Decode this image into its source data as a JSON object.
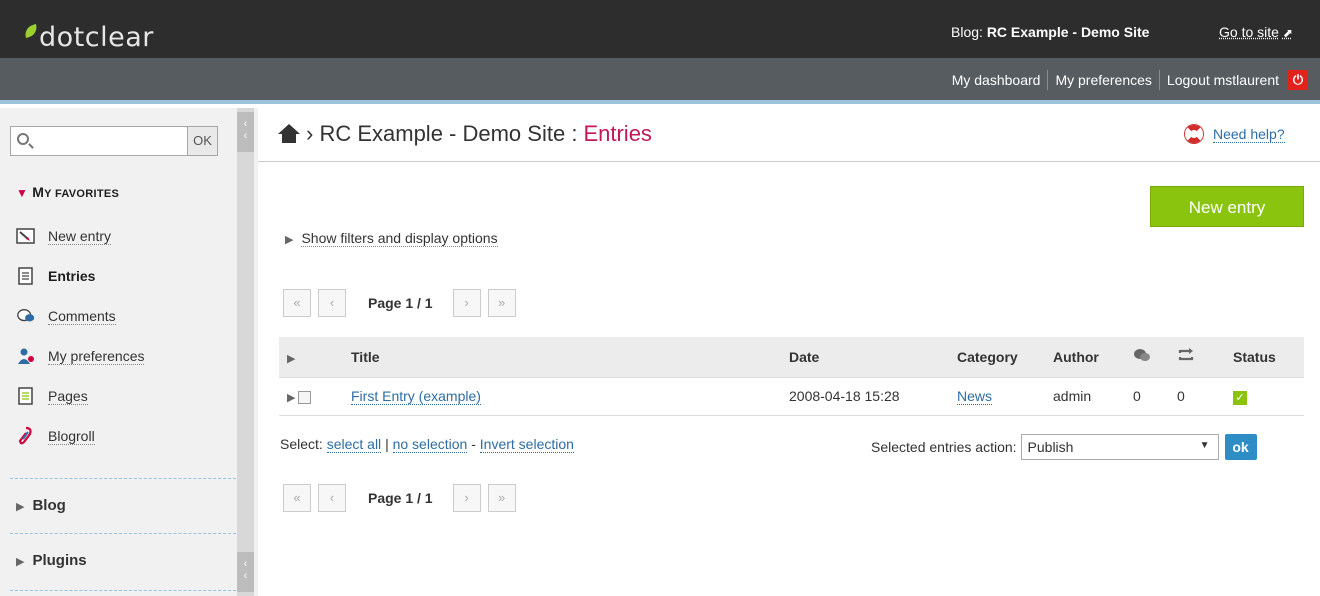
{
  "header": {
    "logo_text": "dotclear",
    "blog_prefix": "Blog:",
    "blog_name": "RC Example - Demo Site",
    "goto_site": "Go to site"
  },
  "topnav": {
    "dashboard": "My dashboard",
    "preferences": "My preferences",
    "logout": "Logout mstlaurent"
  },
  "sidebar": {
    "search_placeholder": "",
    "search_button": "OK",
    "favorites_title_big": "M",
    "favorites_title_small": "Y FAVORITES",
    "items": [
      {
        "label": "New entry",
        "icon": "new-entry-icon"
      },
      {
        "label": "Entries",
        "icon": "entries-icon",
        "active": true
      },
      {
        "label": "Comments",
        "icon": "comments-icon"
      },
      {
        "label": "My preferences",
        "icon": "user-prefs-icon"
      },
      {
        "label": "Pages",
        "icon": "pages-icon"
      },
      {
        "label": "Blogroll",
        "icon": "blogroll-icon"
      }
    ],
    "sections": [
      "Blog",
      "Plugins"
    ]
  },
  "breadcrumb": {
    "site": "RC Example - Demo Site",
    "separator": ":",
    "current": "Entries"
  },
  "help": "Need help?",
  "new_entry_button": "New entry",
  "filters_toggle": "Show filters and display options",
  "pager": {
    "first": "«",
    "prev": "‹",
    "label": "Page 1 / 1",
    "next": "›",
    "last": "»"
  },
  "table": {
    "headers": {
      "title": "Title",
      "date": "Date",
      "category": "Category",
      "author": "Author",
      "status": "Status"
    },
    "rows": [
      {
        "title": "First Entry (example)",
        "date": "2008-04-18 15:28",
        "category": "News",
        "author": "admin",
        "comments": "0",
        "trackbacks": "0",
        "status": "published"
      }
    ]
  },
  "selection": {
    "prefix": "Select:",
    "select_all": "select all",
    "sep1": "|",
    "no_selection": "no selection",
    "sep2": "-",
    "invert": "Invert selection"
  },
  "action": {
    "label": "Selected entries action:",
    "value": "Publish",
    "ok": "ok"
  },
  "colors": {
    "accent": "#c2185b",
    "green": "#8bc40e",
    "link": "#2e6da4",
    "ok_button": "#2e8dc5"
  }
}
